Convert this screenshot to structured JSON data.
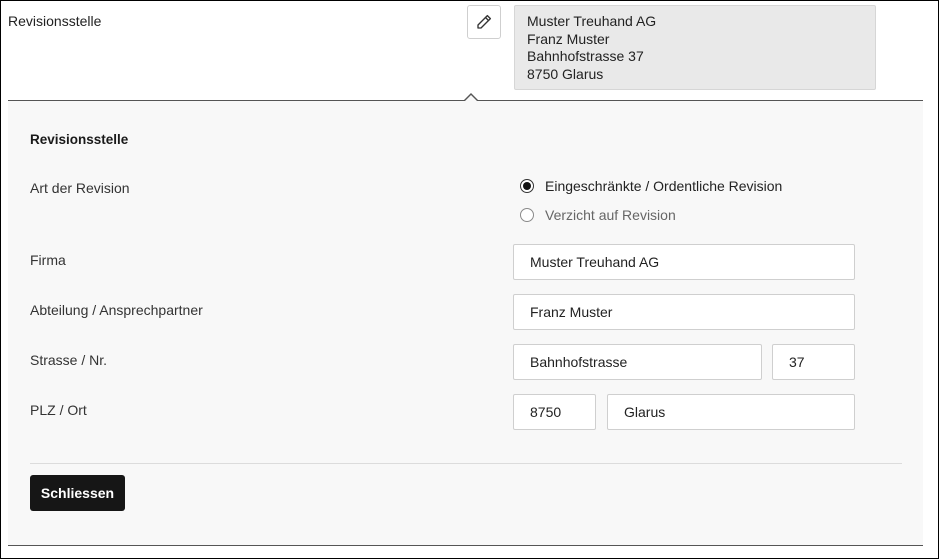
{
  "header": {
    "label": "Revisionsstelle",
    "edit_icon": "pencil-icon",
    "summary_lines": [
      "Muster Treuhand AG",
      "Franz Muster",
      "Bahnhofstrasse 37",
      "8750 Glarus"
    ]
  },
  "form": {
    "title": "Revisionsstelle",
    "art_label": "Art der Revision",
    "radio_options": [
      {
        "label": "Eingeschränkte / Ordentliche Revision",
        "selected": true
      },
      {
        "label": "Verzicht auf Revision",
        "selected": false
      }
    ],
    "firma_label": "Firma",
    "firma_value": "Muster Treuhand AG",
    "abteilung_label": "Abteilung / Ansprechpartner",
    "abteilung_value": "Franz Muster",
    "strasse_label": "Strasse / Nr.",
    "strasse_value": "Bahnhofstrasse",
    "nr_value": "37",
    "plz_label": "PLZ / Ort",
    "plz_value": "8750",
    "ort_value": "Glarus",
    "close_label": "Schliessen"
  },
  "colors": {
    "panel_bg": "#f8f8f8",
    "summary_bg": "#e9e9e9",
    "button_bg": "#161616"
  }
}
